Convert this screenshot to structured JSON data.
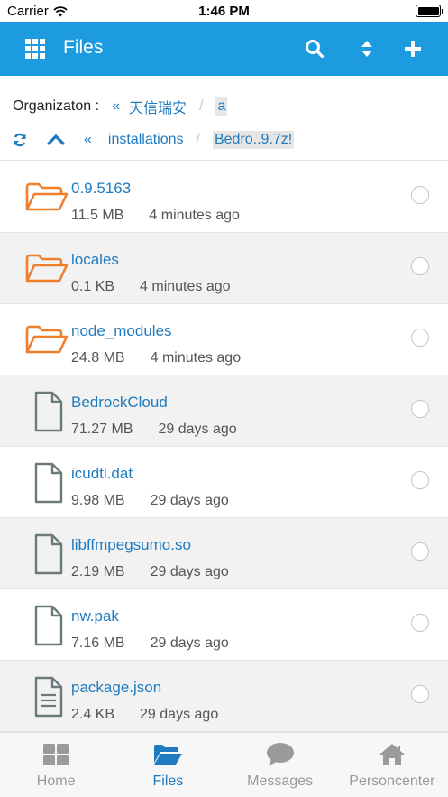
{
  "status_bar": {
    "carrier": "Carrier",
    "time": "1:46 PM"
  },
  "navbar": {
    "title": "Files",
    "icons": [
      "grid-icon",
      "search-icon",
      "sort-icon",
      "plus-icon"
    ],
    "color": "#1d9be0"
  },
  "breadcrumb": {
    "label": "Organizaton :",
    "back_symbol": "«",
    "org_name": "天信瑞安",
    "separator": "/",
    "org_current": "a",
    "path_back_symbol": "«",
    "path_folder": "installations",
    "path_current": "Bedro..9.7z!"
  },
  "files": [
    {
      "name": "0.9.5163",
      "size": "11.5 MB",
      "time": "4 minutes ago",
      "type": "folder"
    },
    {
      "name": "locales",
      "size": "0.1 KB",
      "time": "4 minutes ago",
      "type": "folder"
    },
    {
      "name": "node_modules",
      "size": "24.8 MB",
      "time": "4 minutes ago",
      "type": "folder"
    },
    {
      "name": "BedrockCloud",
      "size": "71.27 MB",
      "time": "29 days ago",
      "type": "file"
    },
    {
      "name": "icudtl.dat",
      "size": "9.98 MB",
      "time": "29 days ago",
      "type": "file"
    },
    {
      "name": "libffmpegsumo.so",
      "size": "2.19 MB",
      "time": "29 days ago",
      "type": "file"
    },
    {
      "name": "nw.pak",
      "size": "7.16 MB",
      "time": "29 days ago",
      "type": "file"
    },
    {
      "name": "package.json",
      "size": "2.4 KB",
      "time": "29 days ago",
      "type": "text-file"
    }
  ],
  "tabs": [
    {
      "label": "Home",
      "icon": "home-grid-icon",
      "active": false
    },
    {
      "label": "Files",
      "icon": "folder-open-icon",
      "active": true
    },
    {
      "label": "Messages",
      "icon": "chat-bubble-icon",
      "active": false
    },
    {
      "label": "Personcenter",
      "icon": "house-icon",
      "active": false
    }
  ],
  "colors": {
    "accent": "#1d9be0",
    "link": "#1f7bbf",
    "folder": "#f07f2d",
    "file": "#6b7b7b"
  }
}
